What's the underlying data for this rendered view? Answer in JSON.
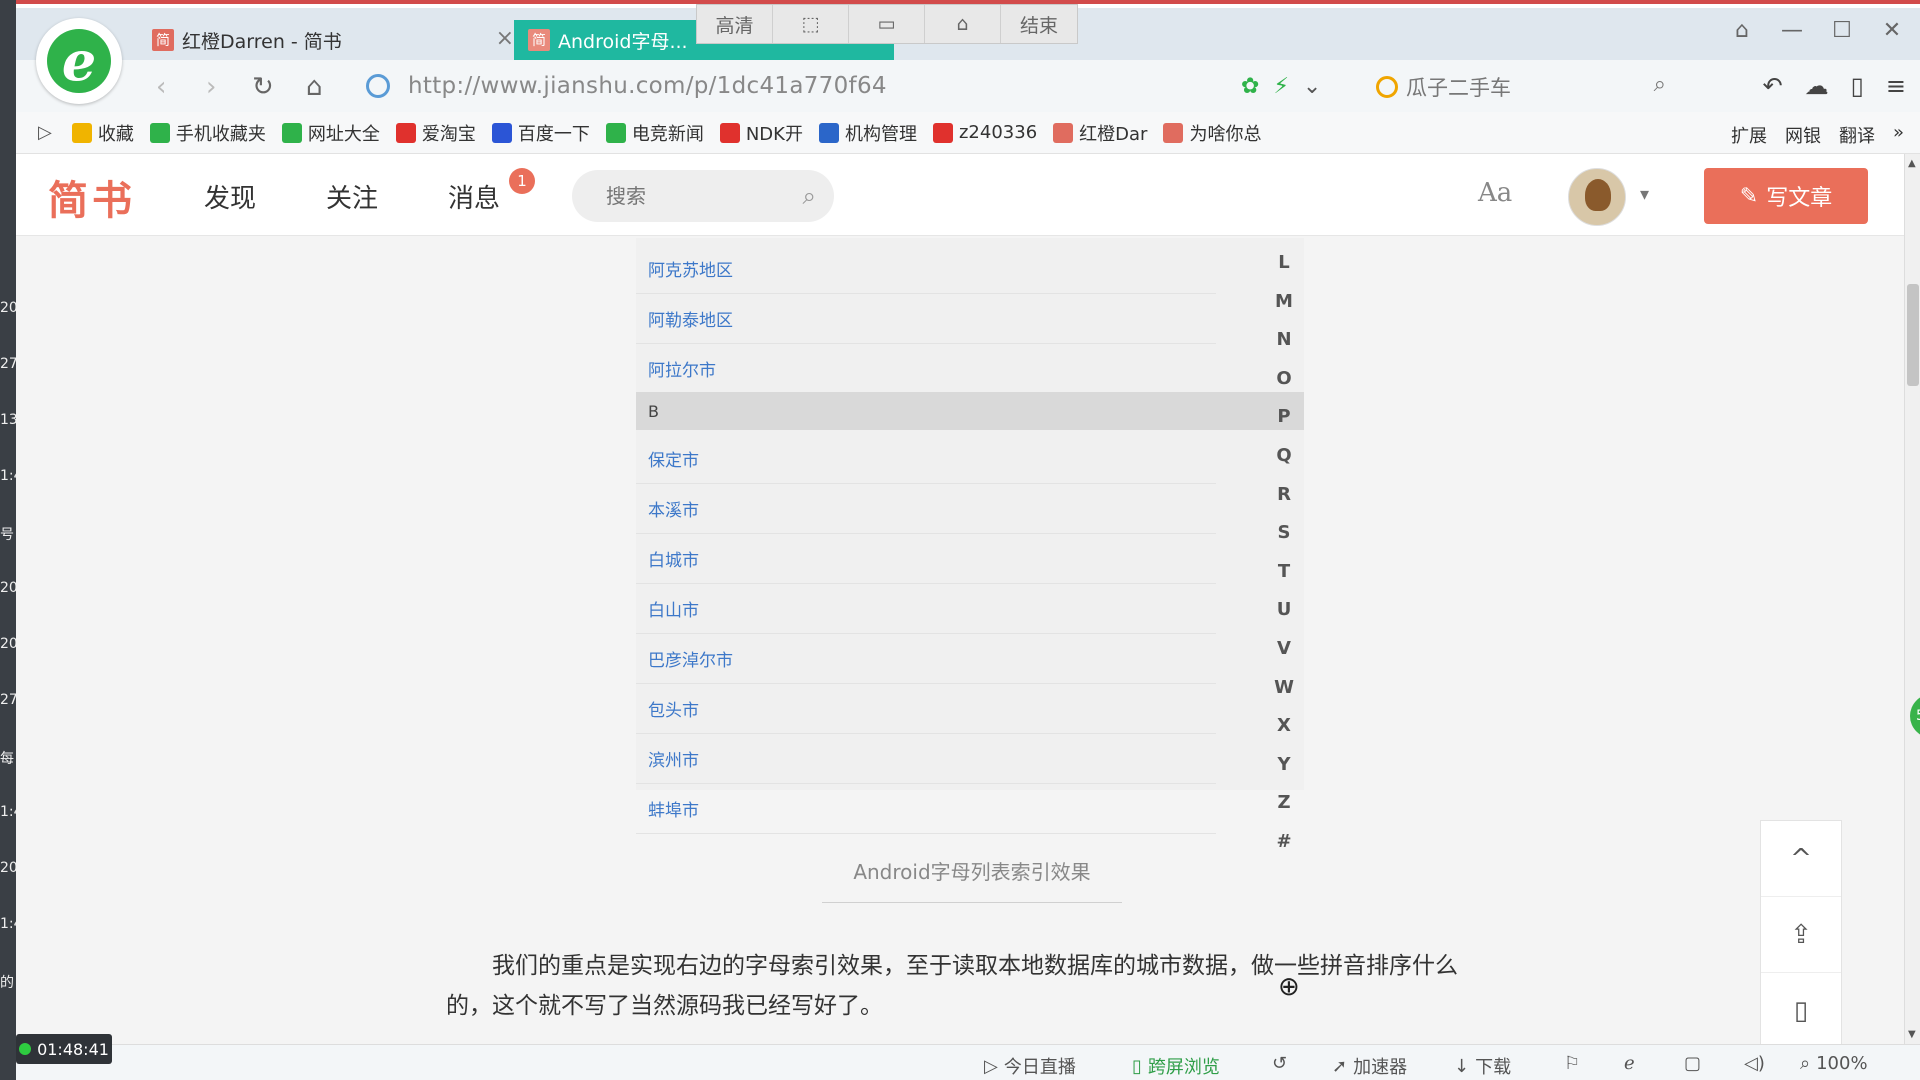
{
  "browser": {
    "tabs": [
      {
        "favicon": "简",
        "title": "红橙Darren - 简书",
        "close": "×"
      },
      {
        "favicon": "简",
        "title": "Android字母..."
      }
    ],
    "recorder_bar": [
      "高清",
      "⬚",
      "▭",
      "⌂",
      "结束"
    ],
    "window_controls": [
      "⌂",
      "—",
      "☐",
      "✕"
    ],
    "url": "http://www.jianshu.com/p/1dc41a770f64",
    "search_engine_text": "瓜子二手车",
    "bookmarks": [
      {
        "label": "收藏",
        "icon": "star-icon",
        "color": "#f0b400"
      },
      {
        "label": "手机收藏夹",
        "icon": "phone-icon",
        "color": "#2fb24a"
      },
      {
        "label": "网址大全",
        "icon": "plus-icon",
        "color": "#2fb24a"
      },
      {
        "label": "爱淘宝",
        "icon": "taobao-icon",
        "color": "#e0312d"
      },
      {
        "label": "百度一下",
        "icon": "baidu-icon",
        "color": "#2b55d6"
      },
      {
        "label": "电竞新闻",
        "icon": "game-icon",
        "color": "#2fb24a"
      },
      {
        "label": "NDK开",
        "icon": "code-icon",
        "color": "#e0312d"
      },
      {
        "label": "机构管理",
        "icon": "org-icon",
        "color": "#2b66c9"
      },
      {
        "label": "z240336",
        "icon": "c-icon",
        "color": "#e0312d"
      },
      {
        "label": "红橙Dar",
        "icon": "jianshu-icon",
        "color": "#e06c5f"
      },
      {
        "label": "为啥你总",
        "icon": "jianshu-icon",
        "color": "#e06c5f"
      }
    ],
    "bookmark_right": [
      "扩展",
      "网银",
      "翻译"
    ]
  },
  "site": {
    "logo": "简书",
    "nav": [
      "发现",
      "关注",
      "消息"
    ],
    "message_badge": "1",
    "search_placeholder": "搜索",
    "font_toggle": "Aa",
    "write_button": "写文章"
  },
  "city_list": {
    "rows_top": [
      "阿克苏地区",
      "阿勒泰地区",
      "阿拉尔市"
    ],
    "section_header": "B",
    "rows_b": [
      "保定市",
      "本溪市",
      "白城市",
      "白山市",
      "巴彦淖尔市",
      "包头市",
      "滨州市",
      "蚌埠市"
    ],
    "letters": [
      "L",
      "M",
      "N",
      "O",
      "P",
      "Q",
      "R",
      "S",
      "T",
      "U",
      "V",
      "W",
      "X",
      "Y",
      "Z",
      "#"
    ]
  },
  "article": {
    "caption": "Android字母列表索引效果",
    "paragraph": "我们的重点是实现右边的字母索引效果，至于读取本地数据库的城市数据，做一些拼音排序什么的，这个就不写了当然源码我已经写好了。"
  },
  "side_tools": [
    "^",
    "⇪",
    "▯",
    "⋰"
  ],
  "statusbar": {
    "timer": "01:48:41",
    "items": [
      "今日直播",
      "跨屏浏览",
      "加速器",
      "下载",
      "100%"
    ]
  },
  "left_strip_fragments": [
    "20",
    "27",
    "13",
    "1:4",
    "号",
    "20",
    "20",
    "27",
    "每",
    "1:4",
    "20",
    "1:4",
    "的"
  ]
}
